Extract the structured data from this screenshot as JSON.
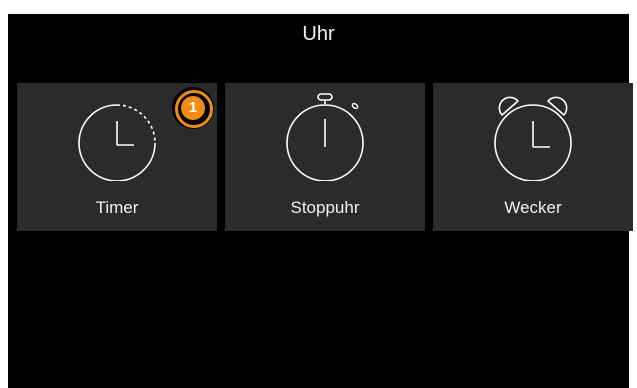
{
  "header": {
    "title": "Uhr"
  },
  "tiles": [
    {
      "label": "Timer",
      "icon": "timer-icon",
      "badge": "1"
    },
    {
      "label": "Stoppuhr",
      "icon": "stopwatch-icon"
    },
    {
      "label": "Wecker",
      "icon": "alarm-clock-icon"
    }
  ],
  "colors": {
    "background": "#000000",
    "tile": "#2b2b2b",
    "text": "#ffffff",
    "badge": "#f28c14"
  }
}
